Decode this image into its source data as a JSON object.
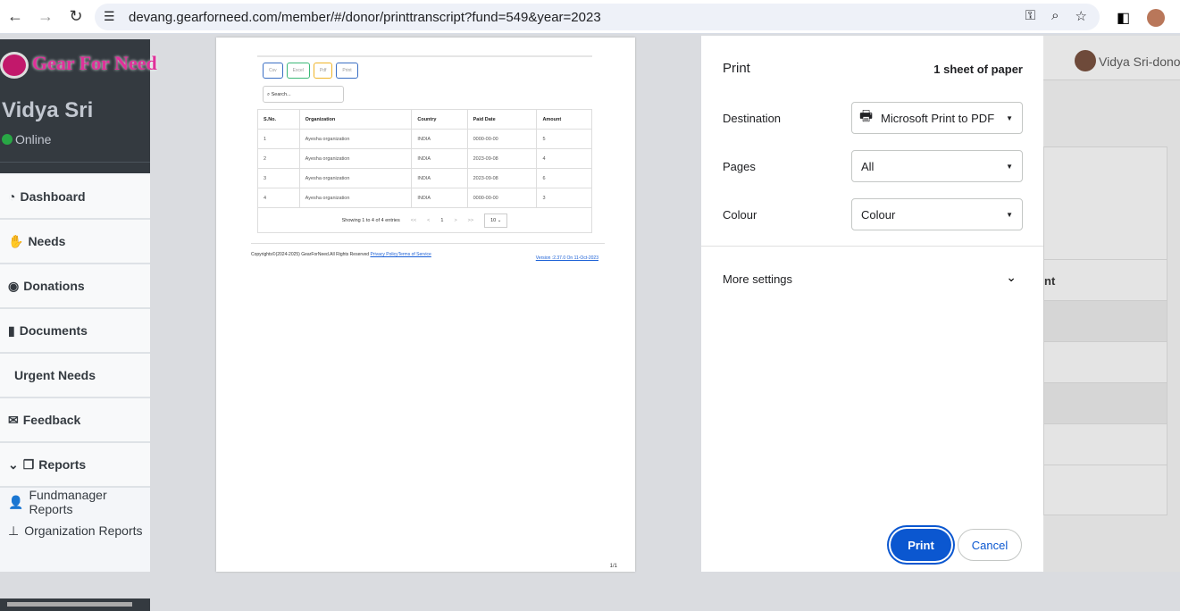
{
  "browser": {
    "url": "devang.gearforneed.com/member/#/donor/printtranscript?fund=549&year=2023"
  },
  "sidebar": {
    "logo_text": "Gear For Need",
    "logo_mark": "FN",
    "user_name": "Vidya Sri",
    "status": "Online",
    "items": [
      {
        "label": "Dashboard",
        "icon": "chart-pie-icon"
      },
      {
        "label": "Needs",
        "icon": "hand-holding-icon"
      },
      {
        "label": "Donations",
        "icon": "donation-icon"
      },
      {
        "label": "Documents",
        "icon": "file-icon"
      },
      {
        "label": "Urgent Needs",
        "icon": ""
      },
      {
        "label": "Feedback",
        "icon": "envelope-icon"
      },
      {
        "label": "Reports",
        "icon": "copy-icon"
      }
    ],
    "subitems": [
      {
        "label": "Fundmanager Reports",
        "icon": "user-icon"
      },
      {
        "label": "Organization Reports",
        "icon": "sitemap-icon"
      }
    ]
  },
  "preview": {
    "buttons": [
      {
        "label": "Csv",
        "color": "#3b6fc4"
      },
      {
        "label": "Excel",
        "color": "#3cb878"
      },
      {
        "label": "Pdf",
        "color": "#f0b429"
      },
      {
        "label": "Print",
        "color": "#3b6fc4"
      }
    ],
    "search_placeholder": "Search...",
    "columns": [
      "S.No.",
      "Organization",
      "Country",
      "Paid Date",
      "Amount"
    ],
    "rows": [
      [
        "1",
        "Ayesha organization",
        "INDIA",
        "0000-00-00",
        "5"
      ],
      [
        "2",
        "Ayesha organization",
        "INDIA",
        "2023-09-08",
        "4"
      ],
      [
        "3",
        "Ayesha organization",
        "INDIA",
        "2023-09-08",
        "6"
      ],
      [
        "4",
        "Ayesha organization",
        "INDIA",
        "0000-00-00",
        "3"
      ]
    ],
    "showing": "Showing 1 to 4 of 4 entries",
    "first": "<<",
    "prev": "<",
    "page": "1",
    "next": ">",
    "last": ">>",
    "page_size": "10",
    "copyright": "Copyrights©(2024-2025) GearForNeed.All Rights Reserved ",
    "privacy": "Privacy Policy",
    "terms": "Terms of Service",
    "version": "Version :2.37.0 On 11-Oct-2023",
    "page_number": "1/1"
  },
  "print": {
    "title": "Print",
    "sheets": "1 sheet of paper",
    "destination_label": "Destination",
    "destination": "Microsoft Print to PDF",
    "pages_label": "Pages",
    "pages": "All",
    "colour_label": "Colour",
    "colour": "Colour",
    "more_settings": "More settings",
    "print_button": "Print",
    "cancel_button": "Cancel"
  },
  "background": {
    "user": "Vidya Sri-donor",
    "column_fragment": "nt"
  }
}
